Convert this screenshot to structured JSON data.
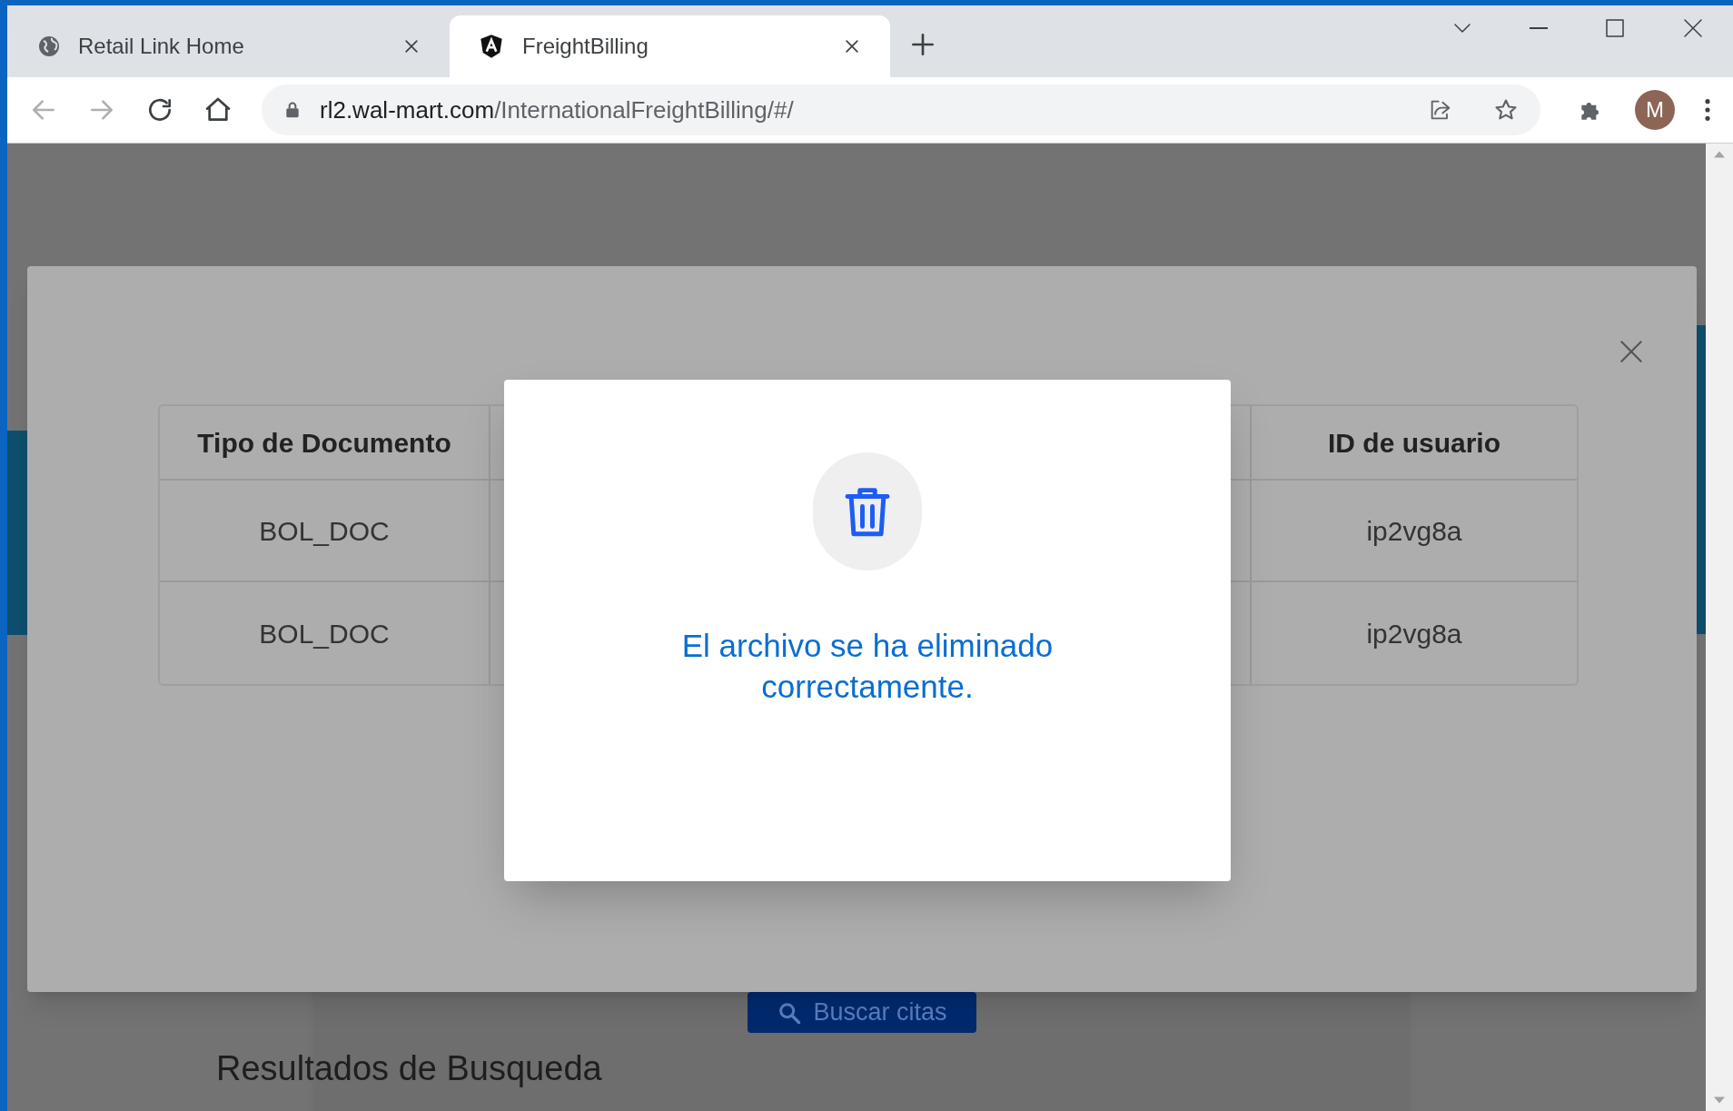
{
  "browser": {
    "tabs": [
      {
        "title": "Retail Link Home",
        "kind": "globe",
        "selected": false
      },
      {
        "title": "FreightBilling",
        "kind": "shield",
        "selected": true
      }
    ],
    "url_host": "rl2.wal-mart.com",
    "url_path": "/InternationalFreightBilling/#/",
    "profile_initial": "M"
  },
  "page": {
    "search_button": "Buscar citas",
    "results_heading": "Resultados de Busqueda"
  },
  "documents_modal": {
    "table": {
      "columns": [
        "Tipo de Documento",
        "ID de usuario"
      ],
      "rows": [
        [
          "BOL_DOC",
          "ip2vg8a"
        ],
        [
          "BOL_DOC",
          "ip2vg8a"
        ]
      ]
    }
  },
  "alert": {
    "message": "El archivo se ha eliminado correctamente."
  }
}
